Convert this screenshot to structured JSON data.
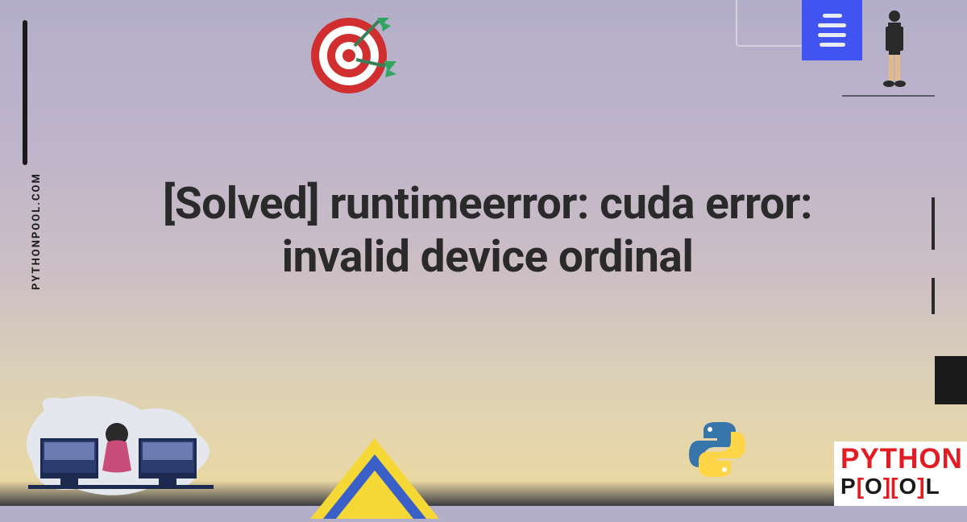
{
  "sidebar": {
    "site_url": "PYTHONPOOL.COM"
  },
  "headline": "[Solved] runtimeerror: cuda error: invalid device ordinal",
  "brand": {
    "line1": "PYTHON",
    "line2_p": "P",
    "line2_o1": "O",
    "line2_o2": "O",
    "line2_l": "L"
  },
  "colors": {
    "accent_blue": "#4154f1",
    "brand_red": "#e31b23",
    "dark": "#1a1a1a"
  }
}
